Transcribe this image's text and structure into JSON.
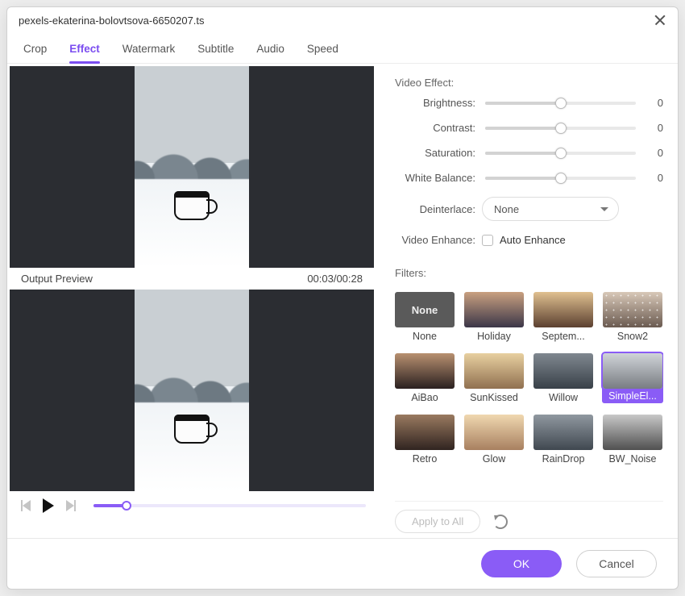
{
  "window": {
    "title": "pexels-ekaterina-bolovtsova-6650207.ts"
  },
  "tabs": [
    {
      "id": "crop",
      "label": "Crop",
      "active": false
    },
    {
      "id": "effect",
      "label": "Effect",
      "active": true
    },
    {
      "id": "watermark",
      "label": "Watermark",
      "active": false
    },
    {
      "id": "subtitle",
      "label": "Subtitle",
      "active": false
    },
    {
      "id": "audio",
      "label": "Audio",
      "active": false
    },
    {
      "id": "speed",
      "label": "Speed",
      "active": false
    }
  ],
  "preview": {
    "output_label": "Output Preview",
    "timecode": "00:03/00:28",
    "progress_percent": 12
  },
  "video_effect": {
    "section_label": "Video Effect:",
    "brightness": {
      "label": "Brightness:",
      "value": 0,
      "percent": 50
    },
    "contrast": {
      "label": "Contrast:",
      "value": 0,
      "percent": 50
    },
    "saturation": {
      "label": "Saturation:",
      "value": 0,
      "percent": 50
    },
    "white_balance": {
      "label": "White Balance:",
      "value": 0,
      "percent": 50
    },
    "deinterlace": {
      "label": "Deinterlace:",
      "selected": "None"
    },
    "enhance": {
      "label": "Video Enhance:",
      "checkbox_label": "Auto Enhance",
      "checked": false
    }
  },
  "filters": {
    "section_label": "Filters:",
    "apply_all_label": "Apply to All",
    "items": [
      {
        "id": "none",
        "label": "None",
        "selected": false
      },
      {
        "id": "holiday",
        "label": "Holiday",
        "selected": false
      },
      {
        "id": "septem",
        "label": "Septem...",
        "selected": false
      },
      {
        "id": "snow2",
        "label": "Snow2",
        "selected": false
      },
      {
        "id": "aibao",
        "label": "AiBao",
        "selected": false
      },
      {
        "id": "sunkissed",
        "label": "SunKissed",
        "selected": false
      },
      {
        "id": "willow",
        "label": "Willow",
        "selected": false
      },
      {
        "id": "simpleel",
        "label": "SimpleEl...",
        "selected": true
      },
      {
        "id": "retro",
        "label": "Retro",
        "selected": false
      },
      {
        "id": "glow",
        "label": "Glow",
        "selected": false
      },
      {
        "id": "raindrop",
        "label": "RainDrop",
        "selected": false
      },
      {
        "id": "bwnoise",
        "label": "BW_Noise",
        "selected": false
      }
    ]
  },
  "footer": {
    "ok": "OK",
    "cancel": "Cancel"
  },
  "colors": {
    "accent": "#8a5cf6"
  }
}
